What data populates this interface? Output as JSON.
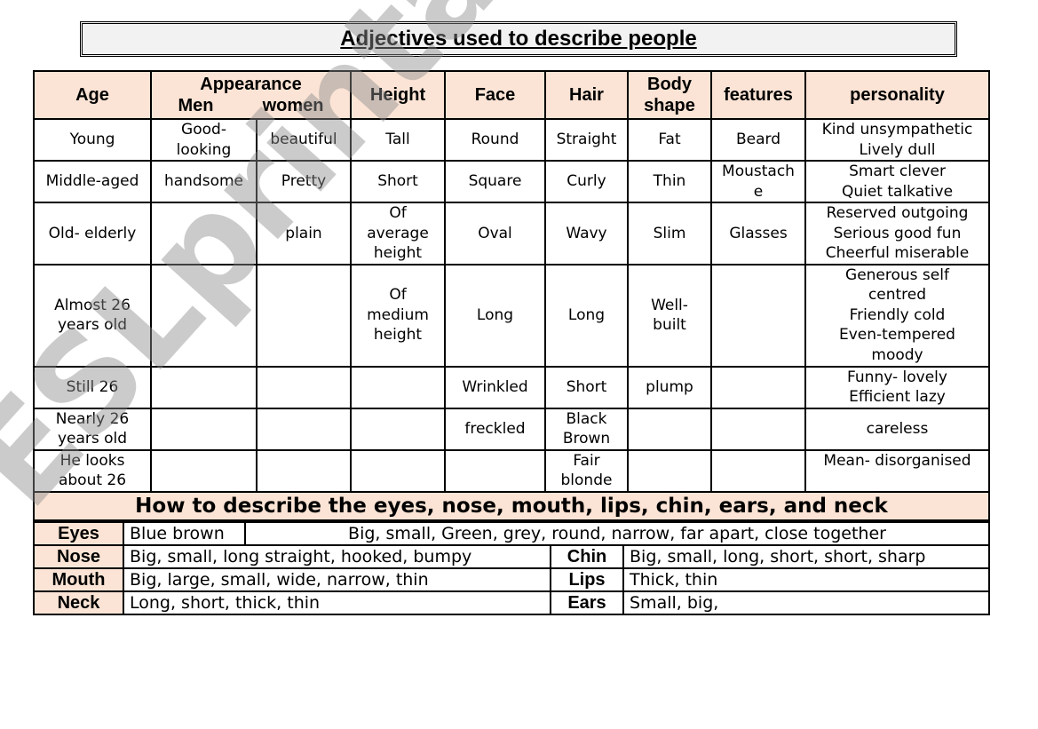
{
  "title": "Adjectives used to describe  people",
  "main_table": {
    "headers": {
      "age": "Age",
      "appearance": "Appearance",
      "appearance_men": "Men",
      "appearance_women": "women",
      "height": "Height",
      "face": "Face",
      "hair": "Hair",
      "body_shape": "Body\nshape",
      "features": "features",
      "personality": "personality"
    },
    "rows": [
      {
        "age": "Young",
        "men": "Good-\nlooking",
        "women": "beautiful",
        "height": "Tall",
        "face": "Round",
        "hair": "Straight",
        "body": "Fat",
        "features": "Beard",
        "personality": "Kind    unsympathetic\nLively  dull"
      },
      {
        "age": "Middle-aged",
        "men": "handsome",
        "women": "Pretty",
        "height": "Short",
        "face": "Square",
        "hair": "Curly",
        "body": "Thin",
        "features": "Moustach\ne",
        "personality": "Smart   clever\nQuiet   talkative"
      },
      {
        "age": "Old- elderly",
        "men": "",
        "women": "plain",
        "height": "Of\naverage\nheight",
        "face": "Oval",
        "hair": "Wavy",
        "body": "Slim",
        "features": "Glasses",
        "personality": "Reserved  outgoing\nSerious    good fun\nCheerful  miserable"
      },
      {
        "age": "Almost 26\nyears old",
        "men": "",
        "women": "",
        "height": "Of\nmedium\nheight",
        "face": "Long",
        "hair": "Long",
        "body": "Well-\nbuilt",
        "features": "",
        "personality": "Generous   self\ncentred\nFriendly  cold\nEven-tempered\nmoody"
      },
      {
        "age": "Still 26",
        "men": "",
        "women": "",
        "height": "",
        "face": "Wrinkled",
        "hair": "Short",
        "body": "plump",
        "features": "",
        "personality": "Funny- lovely\nEfficient   lazy"
      },
      {
        "age": "Nearly 26\nyears old",
        "men": "",
        "women": "",
        "height": "",
        "face": "freckled",
        "hair": "Black\nBrown",
        "body": "",
        "features": "",
        "personality": "careless"
      },
      {
        "age": "He looks\nabout 26",
        "men": "",
        "women": "",
        "height": "",
        "face": "",
        "hair": "Fair\nblonde",
        "body": "",
        "features": "",
        "personality": "Mean- disorganised"
      }
    ],
    "section_title": "How to describe the eyes, nose, mouth, lips, chin, ears, and neck"
  },
  "features_table": {
    "eyes": {
      "label": "Eyes",
      "value1": "Blue brown",
      "value2": "Big, small, Green,  grey, round, narrow, far apart, close together"
    },
    "nose": {
      "label": "Nose",
      "value": "Big, small, long straight, hooked, bumpy"
    },
    "chin": {
      "label": "Chin",
      "value": "Big, small, long, short, short, sharp"
    },
    "mouth": {
      "label": "Mouth",
      "value": "Big, large, small, wide, narrow, thin"
    },
    "lips": {
      "label": "Lips",
      "value": "Thick, thin"
    },
    "neck": {
      "label": "Neck",
      "value": "Long, short, thick, thin"
    },
    "ears": {
      "label": "Ears",
      "value": "Small, big,"
    }
  },
  "watermark": "ESLprintables.com",
  "colors": {
    "header_bg": "#fbe4d5",
    "title_bg": "#f2f2f2",
    "border": "#000000"
  }
}
